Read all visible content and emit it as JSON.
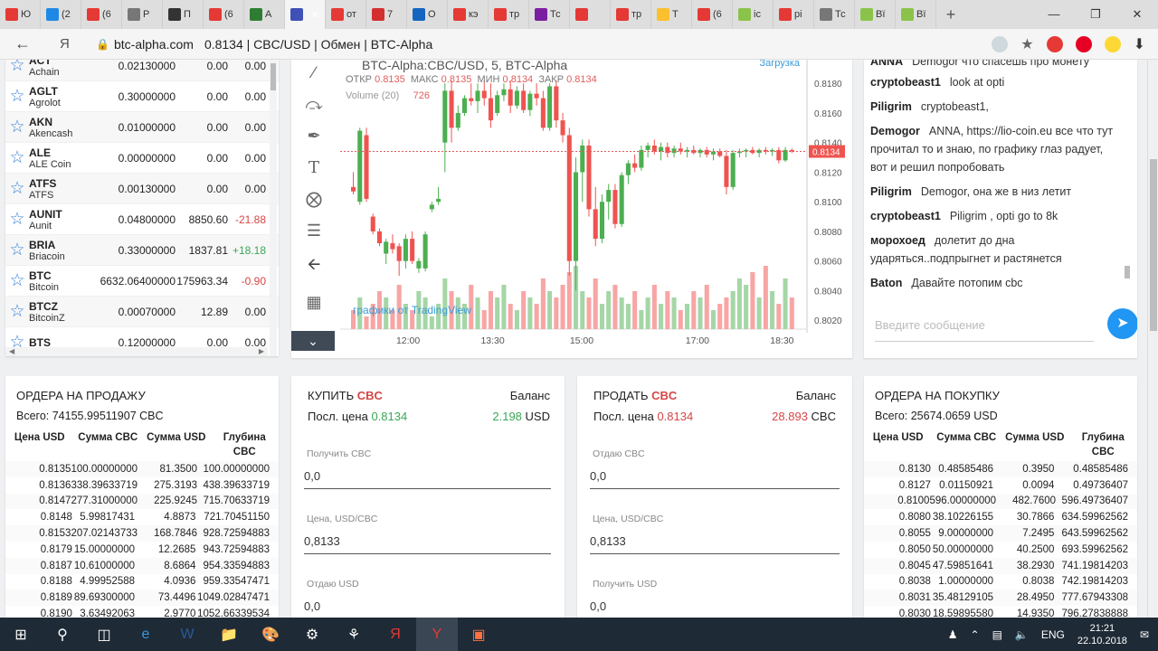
{
  "browser": {
    "tabs": [
      {
        "label": "Ю",
        "color": "#e53935"
      },
      {
        "label": "(2",
        "color": "#1e88e5"
      },
      {
        "label": "(6",
        "color": "#e53935"
      },
      {
        "label": "Р",
        "color": "#777777"
      },
      {
        "label": "П",
        "color": "#333333"
      },
      {
        "label": "(6",
        "color": "#e53935"
      },
      {
        "label": "A",
        "color": "#2e7d32"
      },
      {
        "label": "",
        "color": "#3f51b5",
        "active": true
      },
      {
        "label": "от",
        "color": "#e53935"
      },
      {
        "label": "7",
        "color": "#d32f2f"
      },
      {
        "label": "О",
        "color": "#1565c0"
      },
      {
        "label": "кэ",
        "color": "#e53935"
      },
      {
        "label": "тр",
        "color": "#e53935"
      },
      {
        "label": "Тс",
        "color": "#7b1fa2"
      },
      {
        "label": "",
        "color": "#e53935"
      },
      {
        "label": "тр",
        "color": "#e53935"
      },
      {
        "label": "Т",
        "color": "#fbc02d"
      },
      {
        "label": "(6",
        "color": "#e53935"
      },
      {
        "label": "ic",
        "color": "#8bc34a"
      },
      {
        "label": "рі",
        "color": "#e53935"
      },
      {
        "label": "Тс",
        "color": "#777777"
      },
      {
        "label": "Вї",
        "color": "#8bc34a"
      },
      {
        "label": "Вї",
        "color": "#8bc34a"
      }
    ],
    "address": {
      "host": "btc-alpha.com",
      "title": "0.8134 | CBC/USD | Обмен | BTC-Alpha"
    }
  },
  "coins": [
    {
      "sym": "ACT",
      "name": "Achain",
      "v1": "0.02130000",
      "v2": "0.00",
      "v3": "0.00",
      "dir": ""
    },
    {
      "sym": "AGLT",
      "name": "Agrolot",
      "v1": "0.30000000",
      "v2": "0.00",
      "v3": "0.00",
      "dir": ""
    },
    {
      "sym": "AKN",
      "name": "Akencash",
      "v1": "0.01000000",
      "v2": "0.00",
      "v3": "0.00",
      "dir": ""
    },
    {
      "sym": "ALE",
      "name": "ALE Coin",
      "v1": "0.00000000",
      "v2": "0.00",
      "v3": "0.00",
      "dir": ""
    },
    {
      "sym": "ATFS",
      "name": "ATFS",
      "v1": "0.00130000",
      "v2": "0.00",
      "v3": "0.00",
      "dir": ""
    },
    {
      "sym": "AUNIT",
      "name": "Aunit",
      "v1": "0.04800000",
      "v2": "8850.60",
      "v3": "-21.88",
      "dir": "neg"
    },
    {
      "sym": "BRIA",
      "name": "Briacoin",
      "v1": "0.33000000",
      "v2": "1837.81",
      "v3": "+18.18",
      "dir": "pos"
    },
    {
      "sym": "BTC",
      "name": "Bitcoin",
      "v1": "6632.06400000",
      "v2": "175963.34",
      "v3": "-0.90",
      "dir": "neg"
    },
    {
      "sym": "BTCZ",
      "name": "BitcoinZ",
      "v1": "0.00070000",
      "v2": "12.89",
      "v3": "0.00",
      "dir": ""
    },
    {
      "sym": "BTS",
      "name": "",
      "v1": "0.12000000",
      "v2": "0.00",
      "v3": "0.00",
      "dir": ""
    }
  ],
  "chart": {
    "title": "BTC-Alpha:CBC/USD, 5, BTC-Alpha",
    "ohlc_labels": {
      "open": "ОТКР",
      "high": "МАКС",
      "low": "МИН",
      "close": "ЗАКР"
    },
    "ohlc_values": {
      "open": "0.8135",
      "high": "0.8135",
      "low": "0.8134",
      "close": "0.8134"
    },
    "volume_label": "Volume (20)",
    "volume_value": "726",
    "loading": "Загрузка",
    "watermark": "графики от TradingView",
    "price_tag": "0.8134",
    "colors": {
      "up": "#4caf50",
      "down": "#ef5350",
      "up_vol": "#a5d6a7",
      "down_vol": "#f8a5a5"
    }
  },
  "chart_data": {
    "type": "candlestick",
    "title": "BTC-Alpha:CBC/USD, 5, BTC-Alpha",
    "x_ticks": [
      "12:00",
      "13:30",
      "15:00",
      "17:00",
      "18:30"
    ],
    "y_ticks": [
      "0.8180",
      "0.8160",
      "0.8140",
      "0.8120",
      "0.8100",
      "0.8080",
      "0.8060",
      "0.8040",
      "0.8020"
    ],
    "ylim": [
      0.8014,
      0.8196
    ],
    "last_price": 0.8134,
    "candles": [
      [
        0.811,
        0.812,
        0.8105,
        0.8107
      ],
      [
        0.81,
        0.815,
        0.8098,
        0.8148
      ],
      [
        0.8145,
        0.815,
        0.81,
        0.8102
      ],
      [
        0.809,
        0.8092,
        0.8078,
        0.808
      ],
      [
        0.808,
        0.8082,
        0.807,
        0.8072
      ],
      [
        0.8065,
        0.8075,
        0.8058,
        0.8073
      ],
      [
        0.8072,
        0.8078,
        0.8065,
        0.8068
      ],
      [
        0.807,
        0.8072,
        0.805,
        0.806
      ],
      [
        0.806,
        0.8078,
        0.8055,
        0.8075
      ],
      [
        0.8075,
        0.808,
        0.8058,
        0.806
      ],
      [
        0.8055,
        0.8062,
        0.8052,
        0.806
      ],
      [
        0.8055,
        0.808,
        0.8053,
        0.8078
      ],
      [
        0.8095,
        0.81,
        0.8093,
        0.8098
      ],
      [
        0.81,
        0.811,
        0.8098,
        0.8102
      ],
      [
        0.814,
        0.818,
        0.812,
        0.8175
      ],
      [
        0.8175,
        0.8182,
        0.814,
        0.815
      ],
      [
        0.815,
        0.8165,
        0.8148,
        0.816
      ],
      [
        0.816,
        0.8172,
        0.8158,
        0.817
      ],
      [
        0.817,
        0.818,
        0.8165,
        0.8168
      ],
      [
        0.8168,
        0.818,
        0.816,
        0.8175
      ],
      [
        0.8175,
        0.8182,
        0.8165,
        0.817
      ],
      [
        0.817,
        0.818,
        0.815,
        0.8155
      ],
      [
        0.816,
        0.8175,
        0.8158,
        0.8172
      ],
      [
        0.8172,
        0.818,
        0.8168,
        0.8176
      ],
      [
        0.8176,
        0.8182,
        0.816,
        0.8165
      ],
      [
        0.8165,
        0.8178,
        0.8163,
        0.8175
      ],
      [
        0.8175,
        0.818,
        0.816,
        0.8162
      ],
      [
        0.8162,
        0.8175,
        0.8158,
        0.8173
      ],
      [
        0.8173,
        0.818,
        0.8165,
        0.817
      ],
      [
        0.817,
        0.8175,
        0.8148,
        0.815
      ],
      [
        0.815,
        0.818,
        0.8148,
        0.8178
      ],
      [
        0.8178,
        0.8182,
        0.815,
        0.8155
      ],
      [
        0.8155,
        0.816,
        0.814,
        0.8145
      ],
      [
        0.8145,
        0.815,
        0.805,
        0.806
      ],
      [
        0.806,
        0.813,
        0.804,
        0.812
      ],
      [
        0.812,
        0.8142,
        0.81,
        0.8138
      ],
      [
        0.8138,
        0.8142,
        0.809,
        0.8095
      ],
      [
        0.8095,
        0.811,
        0.807,
        0.8075
      ],
      [
        0.8075,
        0.8105,
        0.8072,
        0.81
      ],
      [
        0.81,
        0.8112,
        0.8088,
        0.8108
      ],
      [
        0.8108,
        0.8112,
        0.8082,
        0.8085
      ],
      [
        0.8085,
        0.812,
        0.8083,
        0.8118
      ],
      [
        0.8118,
        0.8128,
        0.8112,
        0.8126
      ],
      [
        0.8126,
        0.8132,
        0.812,
        0.8123
      ],
      [
        0.8123,
        0.8138,
        0.8121,
        0.8135
      ],
      [
        0.8135,
        0.814,
        0.813,
        0.8138
      ],
      [
        0.8138,
        0.8142,
        0.8132,
        0.8134
      ],
      [
        0.8134,
        0.814,
        0.8128,
        0.8137
      ],
      [
        0.8137,
        0.814,
        0.813,
        0.8133
      ],
      [
        0.8133,
        0.8138,
        0.813,
        0.8136
      ],
      [
        0.8136,
        0.814,
        0.8132,
        0.8134
      ],
      [
        0.8134,
        0.8137,
        0.813,
        0.8135
      ],
      [
        0.8135,
        0.8138,
        0.8132,
        0.8133
      ],
      [
        0.8133,
        0.8136,
        0.813,
        0.8135
      ],
      [
        0.8135,
        0.8137,
        0.813,
        0.8132
      ],
      [
        0.8132,
        0.8136,
        0.8128,
        0.8134
      ],
      [
        0.8134,
        0.8136,
        0.813,
        0.8131
      ],
      [
        0.8131,
        0.8135,
        0.8105,
        0.811
      ],
      [
        0.811,
        0.8135,
        0.8108,
        0.8133
      ],
      [
        0.8133,
        0.8136,
        0.813,
        0.8134
      ],
      [
        0.8134,
        0.8136,
        0.813,
        0.8135
      ],
      [
        0.8135,
        0.8137,
        0.8132,
        0.8133
      ],
      [
        0.8133,
        0.8136,
        0.813,
        0.8135
      ],
      [
        0.8135,
        0.8137,
        0.8132,
        0.8134
      ],
      [
        0.8134,
        0.8136,
        0.8131,
        0.8135
      ],
      [
        0.8135,
        0.8137,
        0.8126,
        0.8128
      ],
      [
        0.8128,
        0.8137,
        0.8127,
        0.8135
      ],
      [
        0.8135,
        0.8136,
        0.8133,
        0.8134
      ]
    ],
    "volumes": [
      3,
      5,
      2,
      4,
      6,
      5,
      3,
      7,
      4,
      3,
      6,
      5,
      2,
      4,
      8,
      6,
      5,
      4,
      7,
      5,
      3,
      6,
      5,
      7,
      4,
      3,
      6,
      5,
      4,
      8,
      6,
      5,
      7,
      9,
      10,
      6,
      5,
      8,
      4,
      6,
      7,
      5,
      4,
      6,
      3,
      5,
      7,
      4,
      6,
      5,
      3,
      4,
      6,
      5,
      7,
      3,
      4,
      5,
      6,
      8,
      7,
      9,
      5,
      10,
      6,
      4,
      8,
      5
    ]
  },
  "chat": {
    "messages": [
      {
        "user": "ANNA",
        "text": "Demogor что спасешь про монету"
      },
      {
        "user": "cryptobeast1",
        "text": "look at opti"
      },
      {
        "user": "Piligrim",
        "text": "cryptobeast1,"
      },
      {
        "user": "Demogor",
        "text": "ANNA, https://lio-coin.eu все что тут прочитал то и знаю, по графику глаз радует, вот и решил попробовать"
      },
      {
        "user": "Piligrim",
        "text": "Demogor, она же в низ летит"
      },
      {
        "user": "cryptobeast1",
        "text": "Piligrim , opti go to 8k"
      },
      {
        "user": "морохоед",
        "text": "долетит до дна ударяться..подпрыгнет и растянется"
      },
      {
        "user": "Baton",
        "text": "Давайте потопим cbc"
      }
    ],
    "input_placeholder": "Введите сообщение"
  },
  "sell_orders": {
    "title": "ОРДЕРА НА ПРОДАЖУ",
    "total": "Всего: 74155.99511907 CBC",
    "headers": [
      "Цена USD",
      "Сумма CBC",
      "Сумма USD",
      "Глубина CBC"
    ],
    "rows": [
      [
        "0.8135",
        "100.00000000",
        "81.3500",
        "100.00000000"
      ],
      [
        "0.8136",
        "338.39633719",
        "275.3193",
        "438.39633719"
      ],
      [
        "0.8147",
        "277.31000000",
        "225.9245",
        "715.70633719"
      ],
      [
        "0.8148",
        "5.99817431",
        "4.8873",
        "721.70451150"
      ],
      [
        "0.8153",
        "207.02143733",
        "168.7846",
        "928.72594883"
      ],
      [
        "0.8179",
        "15.00000000",
        "12.2685",
        "943.72594883"
      ],
      [
        "0.8187",
        "10.61000000",
        "8.6864",
        "954.33594883"
      ],
      [
        "0.8188",
        "4.99952588",
        "4.0936",
        "959.33547471"
      ],
      [
        "0.8189",
        "89.69300000",
        "73.4496",
        "1049.02847471"
      ],
      [
        "0.8190",
        "3.63492063",
        "2.9770",
        "1052.66339534"
      ]
    ]
  },
  "buy_form": {
    "label": "КУПИТЬ",
    "coin": "CBC",
    "balance_label": "Баланс",
    "last_label": "Посл. цена",
    "last_price": "0.8134",
    "balance": "2.198",
    "balance_unit": "USD",
    "f1_label": "Получить CBC",
    "f1_value": "0,0",
    "f2_label": "Цена, USD/CBC",
    "f2_value": "0,8133",
    "f3_label": "Отдаю USD",
    "f3_value": "0,0"
  },
  "sell_form": {
    "label": "ПРОДАТЬ",
    "coin": "CBC",
    "balance_label": "Баланс",
    "last_label": "Посл. цена",
    "last_price": "0.8134",
    "balance": "28.893",
    "balance_unit": "CBC",
    "f1_label": "Отдаю CBC",
    "f1_value": "0,0",
    "f2_label": "Цена, USD/CBC",
    "f2_value": "0,8133",
    "f3_label": "Получить USD",
    "f3_value": "0,0"
  },
  "buy_orders": {
    "title": "ОРДЕРА НА ПОКУПКУ",
    "total": "Всего: 25674.0659 USD",
    "headers": [
      "Цена USD",
      "Сумма CBC",
      "Сумма USD",
      "Глубина CBC"
    ],
    "rows": [
      [
        "0.8130",
        "0.48585486",
        "0.3950",
        "0.48585486"
      ],
      [
        "0.8127",
        "0.01150921",
        "0.0094",
        "0.49736407"
      ],
      [
        "0.8100",
        "596.00000000",
        "482.7600",
        "596.49736407"
      ],
      [
        "0.8080",
        "38.10226155",
        "30.7866",
        "634.59962562"
      ],
      [
        "0.8055",
        "9.00000000",
        "7.2495",
        "643.59962562"
      ],
      [
        "0.8050",
        "50.00000000",
        "40.2500",
        "693.59962562"
      ],
      [
        "0.8045",
        "47.59851641",
        "38.2930",
        "741.19814203"
      ],
      [
        "0.8038",
        "1.00000000",
        "0.8038",
        "742.19814203"
      ],
      [
        "0.8031",
        "35.48129105",
        "28.4950",
        "777.67943308"
      ],
      [
        "0.8030",
        "18.59895580",
        "14.9350",
        "796.27838888"
      ]
    ]
  },
  "taskbar": {
    "lang": "ENG",
    "time": "21:21",
    "date": "22.10.2018"
  }
}
